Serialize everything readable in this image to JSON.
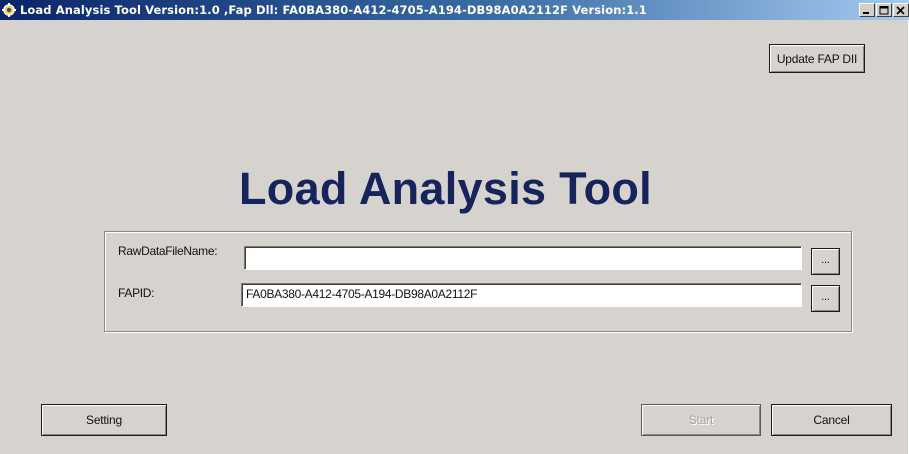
{
  "window": {
    "title": "Load Analysis Tool Version:1.0  ,Fap Dll: FA0BA380-A412-4705-A194-DB98A0A2112F Version:1.1"
  },
  "toolbar": {
    "update_fap_dll_label": "Update FAP DII"
  },
  "main": {
    "heading": "Load Analysis Tool"
  },
  "form": {
    "raw_data_file": {
      "label": "RawDataFileName:",
      "value": "",
      "browse_label": "..."
    },
    "fapid": {
      "label": "FAPID:",
      "value": "FA0BA380-A412-4705-A194-DB98A0A2112F",
      "browse_label": "..."
    }
  },
  "footer": {
    "setting_label": "Setting",
    "start_label": "Start",
    "cancel_label": "Cancel"
  }
}
